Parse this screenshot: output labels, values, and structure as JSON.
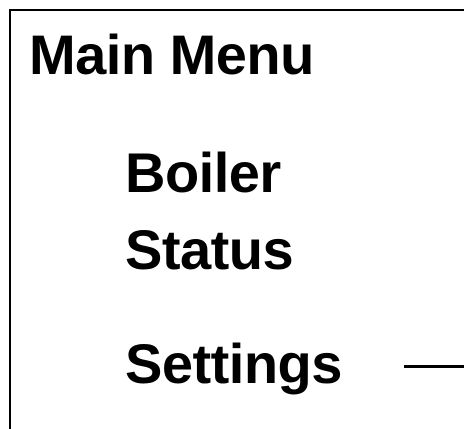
{
  "menu": {
    "title": "Main Menu",
    "items": [
      {
        "lines": [
          "Boiler",
          "Status"
        ]
      },
      {
        "lines": [
          "Settings"
        ]
      }
    ]
  },
  "colors": {
    "background": "#ffffff",
    "foreground": "#000000"
  }
}
